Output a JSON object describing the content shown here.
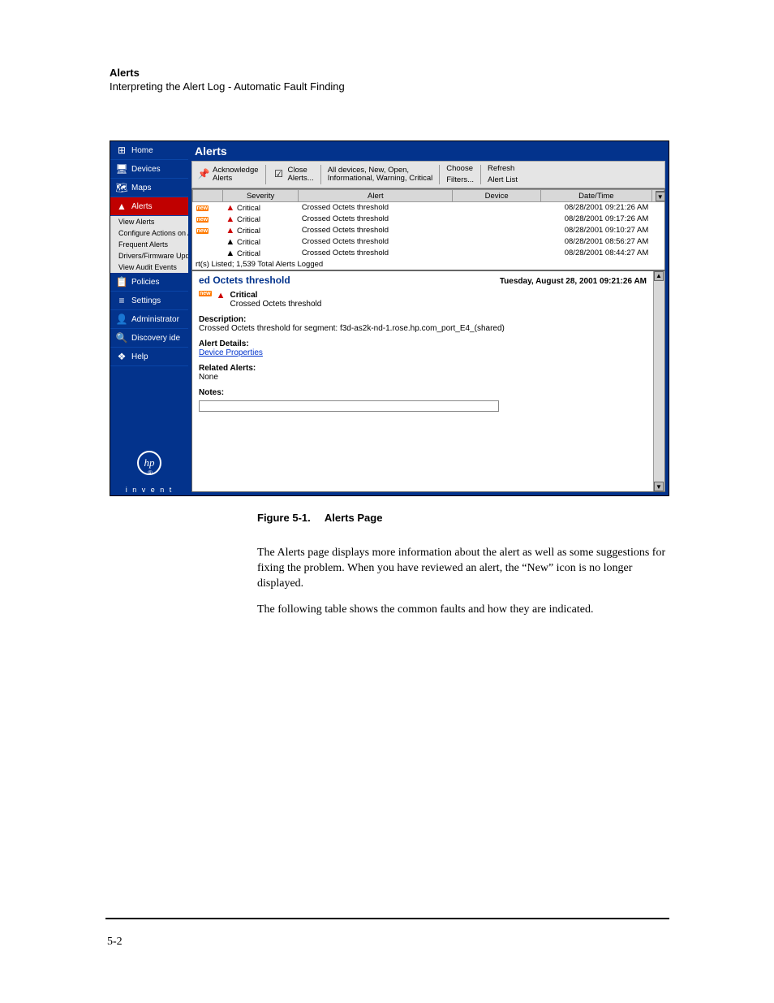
{
  "header": {
    "title": "Alerts",
    "subtitle": "Interpreting the Alert Log - Automatic Fault Finding"
  },
  "sidebar": {
    "items": [
      {
        "label": "Home",
        "icon": "⊞"
      },
      {
        "label": "Devices",
        "icon": "🖥"
      },
      {
        "label": "Maps",
        "icon": "🗺"
      },
      {
        "label": "Alerts",
        "icon": "▲",
        "active": true
      },
      {
        "label": "Policies",
        "icon": "📋"
      },
      {
        "label": "Settings",
        "icon": "≡"
      },
      {
        "label": "Administrator",
        "icon": "👤"
      },
      {
        "label": "Discovery ide",
        "icon": "🔍"
      },
      {
        "label": "Help",
        "icon": "❖"
      }
    ],
    "alerts_sub": [
      "View Alerts",
      "Configure Actions on Alerts",
      "Frequent Alerts",
      "Drivers/Firmware Update Status",
      "View Audit Events"
    ],
    "logo_text": "hp",
    "logo_tag": "i n v e n t"
  },
  "main": {
    "title": "Alerts",
    "toolbar": {
      "ack": {
        "line1": "Acknowledge",
        "line2": "Alerts"
      },
      "close": {
        "line1": "Close",
        "line2": "Alerts..."
      },
      "filter_info": {
        "line1": "All devices, New, Open,",
        "line2": "Informational, Warning, Critical"
      },
      "choose": {
        "line1": "Choose",
        "line2": "Filters..."
      },
      "refresh": {
        "line1": "Refresh",
        "line2": "Alert List"
      }
    },
    "columns": {
      "severity": "Severity",
      "alert": "Alert",
      "device": "Device",
      "datetime": "Date/Time"
    },
    "rows": [
      {
        "new": true,
        "sev_red": true,
        "severity": "Critical",
        "alert": "Crossed Octets threshold",
        "device": "",
        "datetime": "08/28/2001 09:21:26 AM"
      },
      {
        "new": true,
        "sev_red": true,
        "severity": "Critical",
        "alert": "Crossed Octets threshold",
        "device": "",
        "datetime": "08/28/2001 09:17:26 AM"
      },
      {
        "new": true,
        "sev_red": true,
        "severity": "Critical",
        "alert": "Crossed Octets threshold",
        "device": "",
        "datetime": "08/28/2001 09:10:27 AM"
      },
      {
        "new": false,
        "sev_red": false,
        "severity": "Critical",
        "alert": "Crossed Octets threshold",
        "device": "",
        "datetime": "08/28/2001 08:56:27 AM"
      },
      {
        "new": false,
        "sev_red": false,
        "severity": "Critical",
        "alert": "Crossed Octets threshold",
        "device": "",
        "datetime": "08/28/2001 08:44:27 AM"
      }
    ],
    "status": "rt(s) Listed; 1,539 Total Alerts Logged",
    "detail": {
      "title": "ed Octets threshold",
      "date": "Tuesday, August 28, 2001 09:21:26 AM",
      "new_badge": "new",
      "severity": "Critical",
      "alert_name": "Crossed Octets threshold",
      "desc_label": "Description:",
      "desc_text": "Crossed Octets threshold for segment: f3d-as2k-nd-1.rose.hp.com_port_E4_(shared)",
      "details_label": "Alert Details:",
      "details_link": "Device Properties",
      "related_label": "Related Alerts:",
      "related_text": "None",
      "notes_label": "Notes:"
    }
  },
  "caption": {
    "label": "Figure 5-1.",
    "text": "Alerts Page"
  },
  "body": {
    "p1": "The Alerts page displays more information about the alert as well as some suggestions for fixing the problem. When you have reviewed an alert, the “New” icon is no longer displayed.",
    "p2": "The following table shows the common faults and how they are indicated."
  },
  "page_number": "5-2"
}
